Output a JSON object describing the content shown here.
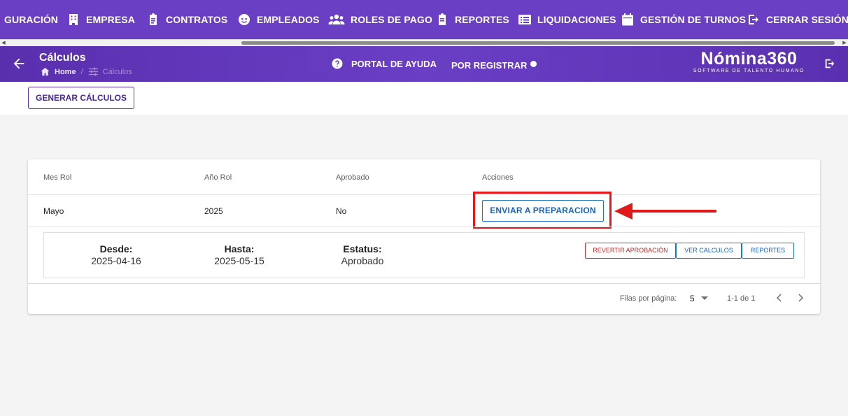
{
  "topnav": {
    "items": [
      {
        "label": "GURACIÓN",
        "icon": "settings-icon"
      },
      {
        "label": "EMPRESA",
        "icon": "building-icon"
      },
      {
        "label": "CONTRATOS",
        "icon": "clipboard-icon"
      },
      {
        "label": "EMPLEADOS",
        "icon": "face-icon"
      },
      {
        "label": "ROLES DE PAGO",
        "icon": "people-icon"
      },
      {
        "label": "REPORTES",
        "icon": "report-icon"
      },
      {
        "label": "LIQUIDACIONES",
        "icon": "list-icon"
      },
      {
        "label": "GESTIÓN DE TURNOS",
        "icon": "calendar-icon"
      },
      {
        "label": "CERRAR SESIÓN",
        "icon": "logout-icon"
      }
    ]
  },
  "header": {
    "title": "Cálculos",
    "breadcrumb": {
      "home": "Home",
      "current": "Cálculos"
    },
    "help_label": "PORTAL DE AYUDA",
    "register_label": "POR REGISTRAR",
    "logo": {
      "main": "Nómina360",
      "sub": "SOFTWARE DE TALENTO HUMANO"
    }
  },
  "toolbar": {
    "generate_label": "GENERAR CÁLCULOS"
  },
  "table": {
    "headers": [
      "Mes Rol",
      "Año Rol",
      "Aprobado",
      "Acciones"
    ],
    "rows": [
      {
        "mes": "Mayo",
        "anio": "2025",
        "aprobado": "No",
        "action_label": "ENVIAR A PREPARACION"
      }
    ],
    "detail": {
      "desde_label": "Desde:",
      "desde": "2025-04-16",
      "hasta_label": "Hasta:",
      "hasta": "2025-05-15",
      "estatus_label": "Estatus:",
      "estatus": "Aprobado",
      "actions": [
        "REVERTIR APROBACIÓN",
        "VER CALCULOS",
        "REPORTES"
      ]
    },
    "pagination": {
      "rows_per_page_label": "Filas por página:",
      "rows_per_page": "5",
      "range": "1-1 de 1"
    }
  },
  "colors": {
    "nav_bg": "#6a3fc4",
    "header_bg": "#5a2fae",
    "primary_blue": "#1565c0",
    "revert_red": "#c62828",
    "annotation_red": "#e1191b",
    "page_bg": "#f4f4f4"
  }
}
